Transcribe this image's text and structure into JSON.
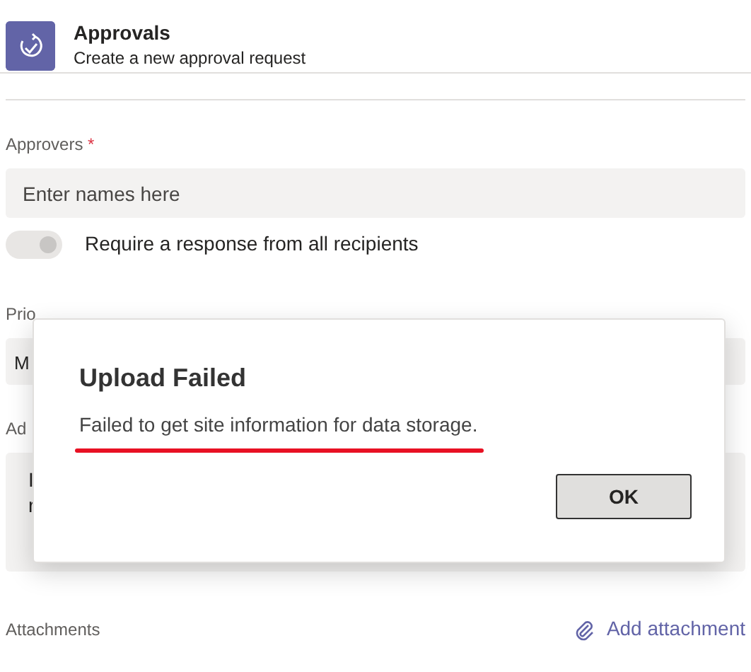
{
  "header": {
    "title": "Approvals",
    "subtitle": "Create a new approval request"
  },
  "form": {
    "approvers_label": "Approvers",
    "required_mark": "*",
    "approvers_field": {
      "placeholder": "Enter names here"
    },
    "toggle": {
      "label": "Require a response from all recipients",
      "on": true,
      "disabled": true
    },
    "priority_label": "Prio",
    "priority_value": "M",
    "details_label": "Ad",
    "details_lines": [
      "I",
      "r"
    ],
    "attachments_label": "Attachments",
    "add_attachment": "Add attachment"
  },
  "dialog": {
    "title": "Upload Failed",
    "message": "Failed to get site information for data storage.",
    "underlined": true,
    "buttons": [
      "OK"
    ]
  }
}
